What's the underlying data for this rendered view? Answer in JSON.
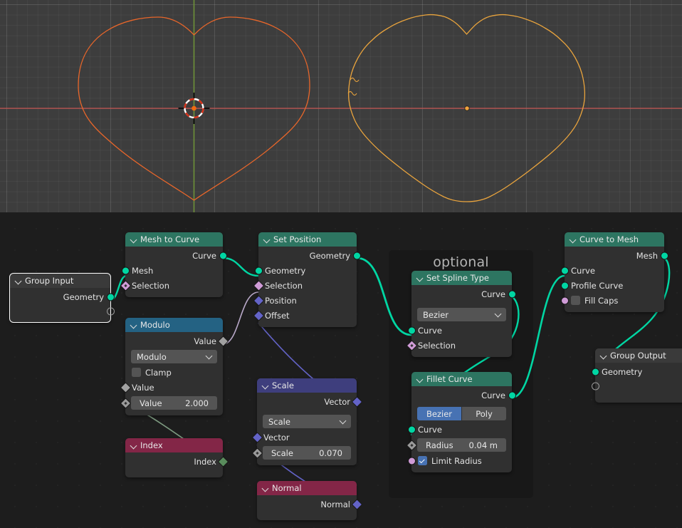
{
  "viewport": {
    "name": "3d-viewport",
    "background": "#3d3d3d",
    "axis_x_color": "#c85151",
    "axis_y_color": "#709a3c",
    "left_object_color": "#e8662a",
    "right_object_color": "#e8a33d",
    "cursor_label": "3d-cursor"
  },
  "node_editor": {
    "background": "#1d1d1d",
    "frames": [
      {
        "label": "optional"
      }
    ],
    "nodes": [
      {
        "id": "group-input",
        "title": "Group Input",
        "header_color": "#3a3a3a",
        "selected": true,
        "outputs": [
          {
            "label": "Geometry",
            "socket": "geometry"
          },
          {
            "label": "",
            "socket": "virtual"
          }
        ],
        "inputs": []
      },
      {
        "id": "mesh-to-curve",
        "title": "Mesh to Curve",
        "header_color": "#2d7561",
        "outputs": [
          {
            "label": "Curve",
            "socket": "geometry"
          }
        ],
        "inputs": [
          {
            "label": "Mesh",
            "socket": "geometry"
          },
          {
            "label": "Selection",
            "socket": "boolean"
          }
        ]
      },
      {
        "id": "modulo",
        "title": "Modulo",
        "header_color": "#246283",
        "outputs": [
          {
            "label": "Value",
            "socket": "float"
          }
        ],
        "dropdown": {
          "label": "Modulo"
        },
        "checkbox": {
          "label": "Clamp",
          "checked": false
        },
        "inputs": [
          {
            "label": "Value",
            "socket": "float"
          },
          {
            "label": "Value",
            "socket": "float",
            "field": {
              "name": "Value",
              "value": "2.000"
            }
          }
        ]
      },
      {
        "id": "index",
        "title": "Index",
        "header_color": "#832647",
        "outputs": [
          {
            "label": "Index",
            "socket": "integer"
          }
        ],
        "inputs": []
      },
      {
        "id": "set-position",
        "title": "Set Position",
        "header_color": "#2d7561",
        "outputs": [
          {
            "label": "Geometry",
            "socket": "geometry"
          }
        ],
        "inputs": [
          {
            "label": "Geometry",
            "socket": "geometry"
          },
          {
            "label": "Selection",
            "socket": "boolean"
          },
          {
            "label": "Position",
            "socket": "vector"
          },
          {
            "label": "Offset",
            "socket": "vector"
          }
        ]
      },
      {
        "id": "scale",
        "title": "Scale",
        "header_color": "#3e3e7d",
        "outputs": [
          {
            "label": "Vector",
            "socket": "vector"
          }
        ],
        "dropdown": {
          "label": "Scale"
        },
        "inputs": [
          {
            "label": "Vector",
            "socket": "vector"
          },
          {
            "label": "",
            "socket": "float",
            "field": {
              "name": "Scale",
              "value": "0.070"
            }
          }
        ]
      },
      {
        "id": "normal",
        "title": "Normal",
        "header_color": "#832647",
        "outputs": [
          {
            "label": "Normal",
            "socket": "vector"
          }
        ],
        "inputs": []
      },
      {
        "id": "set-spline-type",
        "title": "Set Spline Type",
        "header_color": "#2d7561",
        "outputs": [
          {
            "label": "Curve",
            "socket": "geometry"
          }
        ],
        "dropdown": {
          "label": "Bezier"
        },
        "inputs": [
          {
            "label": "Curve",
            "socket": "geometry"
          },
          {
            "label": "Selection",
            "socket": "boolean"
          }
        ]
      },
      {
        "id": "fillet-curve",
        "title": "Fillet Curve",
        "header_color": "#2d7561",
        "outputs": [
          {
            "label": "Curve",
            "socket": "geometry"
          }
        ],
        "segmented": {
          "options": [
            "Bezier",
            "Poly"
          ],
          "active": "Bezier"
        },
        "inputs": [
          {
            "label": "Curve",
            "socket": "geometry"
          },
          {
            "label": "",
            "socket": "float",
            "field": {
              "name": "Radius",
              "value": "0.04 m"
            }
          },
          {
            "label": "Limit Radius",
            "socket": "boolean_solid",
            "checked": true
          }
        ]
      },
      {
        "id": "curve-to-mesh",
        "title": "Curve to Mesh",
        "header_color": "#2d7561",
        "outputs": [
          {
            "label": "Mesh",
            "socket": "geometry"
          }
        ],
        "inputs": [
          {
            "label": "Curve",
            "socket": "geometry"
          },
          {
            "label": "Profile Curve",
            "socket": "geometry"
          },
          {
            "label": "Fill Caps",
            "socket": "boolean_solid",
            "checked": false
          }
        ]
      },
      {
        "id": "group-output",
        "title": "Group Output",
        "header_color": "#3a3a3a",
        "inputs": [
          {
            "label": "Geometry",
            "socket": "geometry"
          },
          {
            "label": "",
            "socket": "virtual"
          }
        ],
        "outputs": []
      }
    ],
    "socket_colors": {
      "geometry": "#00d6a3",
      "boolean": "#cf9bd6",
      "vector": "#6363c7",
      "float": "#a1a1a1",
      "integer": "#598c5c",
      "virtual": "#9a9a9a"
    },
    "links": [
      {
        "from": "group-input.Geometry",
        "to": "mesh-to-curve.Mesh",
        "color": "#00d6a3"
      },
      {
        "from": "mesh-to-curve.Curve",
        "to": "set-position.Geometry",
        "color": "#00d6a3"
      },
      {
        "from": "modulo.Value",
        "to": "set-position.Selection",
        "color": "#b8a8c8"
      },
      {
        "from": "index.Index",
        "to": "modulo.Value",
        "color": "#7d9a80"
      },
      {
        "from": "normal.Normal",
        "to": "scale.Vector",
        "color": "#6363c7"
      },
      {
        "from": "scale.Vector",
        "to": "set-position.Offset",
        "color": "#6363c7"
      },
      {
        "from": "set-position.Geometry",
        "to": "set-spline-type.Curve",
        "color": "#00d6a3"
      },
      {
        "from": "set-spline-type.Curve",
        "to": "fillet-curve.Curve",
        "color": "#00d6a3"
      },
      {
        "from": "fillet-curve.Curve",
        "to": "curve-to-mesh.Curve",
        "color": "#00d6a3"
      },
      {
        "from": "curve-to-mesh.Mesh",
        "to": "group-output.Geometry",
        "color": "#00d6a3"
      }
    ]
  }
}
